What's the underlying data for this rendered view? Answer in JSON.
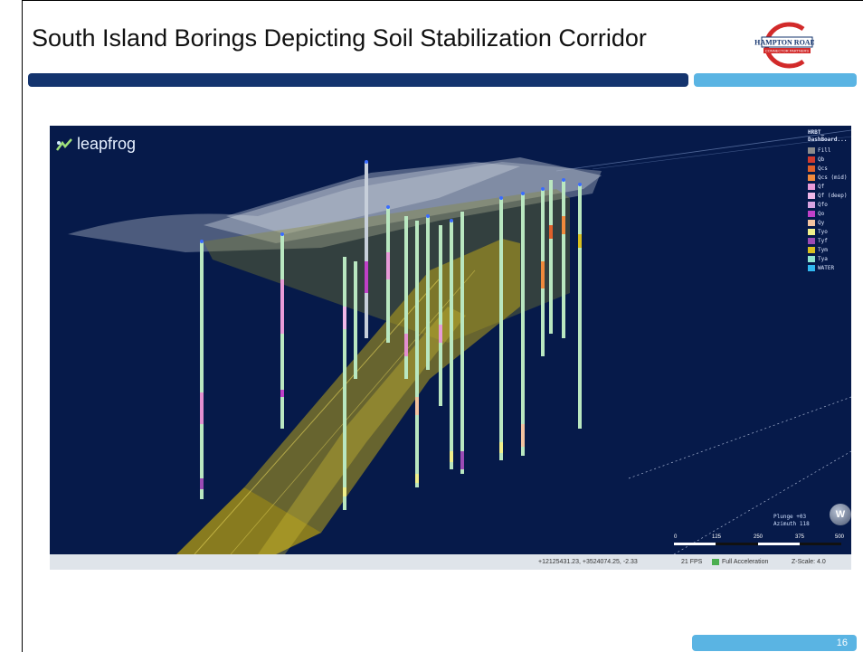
{
  "slide": {
    "title": "South Island Borings Depicting Soil Stabilization Corridor",
    "page_number": "16",
    "logo": {
      "line1": "HAMPTON ROADS",
      "line2": "CONNECTOR PARTNERS"
    }
  },
  "viewer": {
    "brand": "leapfrog",
    "legend": {
      "header_line1": "HRBT_",
      "header_line2": "DashBoard...",
      "items": [
        {
          "label": "Fill",
          "color": "#8c8c8c"
        },
        {
          "label": "Qb",
          "color": "#d03a2e"
        },
        {
          "label": "Qcs",
          "color": "#e0602a"
        },
        {
          "label": "Qcs (mid)",
          "color": "#f08a3c"
        },
        {
          "label": "Qf",
          "color": "#e89bd8"
        },
        {
          "label": "Qf (deep)",
          "color": "#f0b8e8"
        },
        {
          "label": "Qfo",
          "color": "#d7a3e0"
        },
        {
          "label": "Qo",
          "color": "#c040c8"
        },
        {
          "label": "Qy",
          "color": "#f3c3a0"
        },
        {
          "label": "Tyo",
          "color": "#f0f08a"
        },
        {
          "label": "Tyf",
          "color": "#9b4bb5"
        },
        {
          "label": "Tym",
          "color": "#d8c020"
        },
        {
          "label": "Tya",
          "color": "#8fe6d0"
        },
        {
          "label": "WATER",
          "color": "#30b8f0"
        }
      ]
    },
    "plunge_text": "Plunge +03",
    "azimuth_text": "Azimuth 118",
    "compass_label": "W",
    "scale_ticks": [
      "0",
      "125",
      "250",
      "375",
      "500"
    ],
    "status": {
      "coords": "+12125431.23, +3524074.25, -2.33",
      "fps": "21 FPS",
      "acceleration": "Full Acceleration",
      "zscale": "Z-Scale: 4.0"
    }
  }
}
